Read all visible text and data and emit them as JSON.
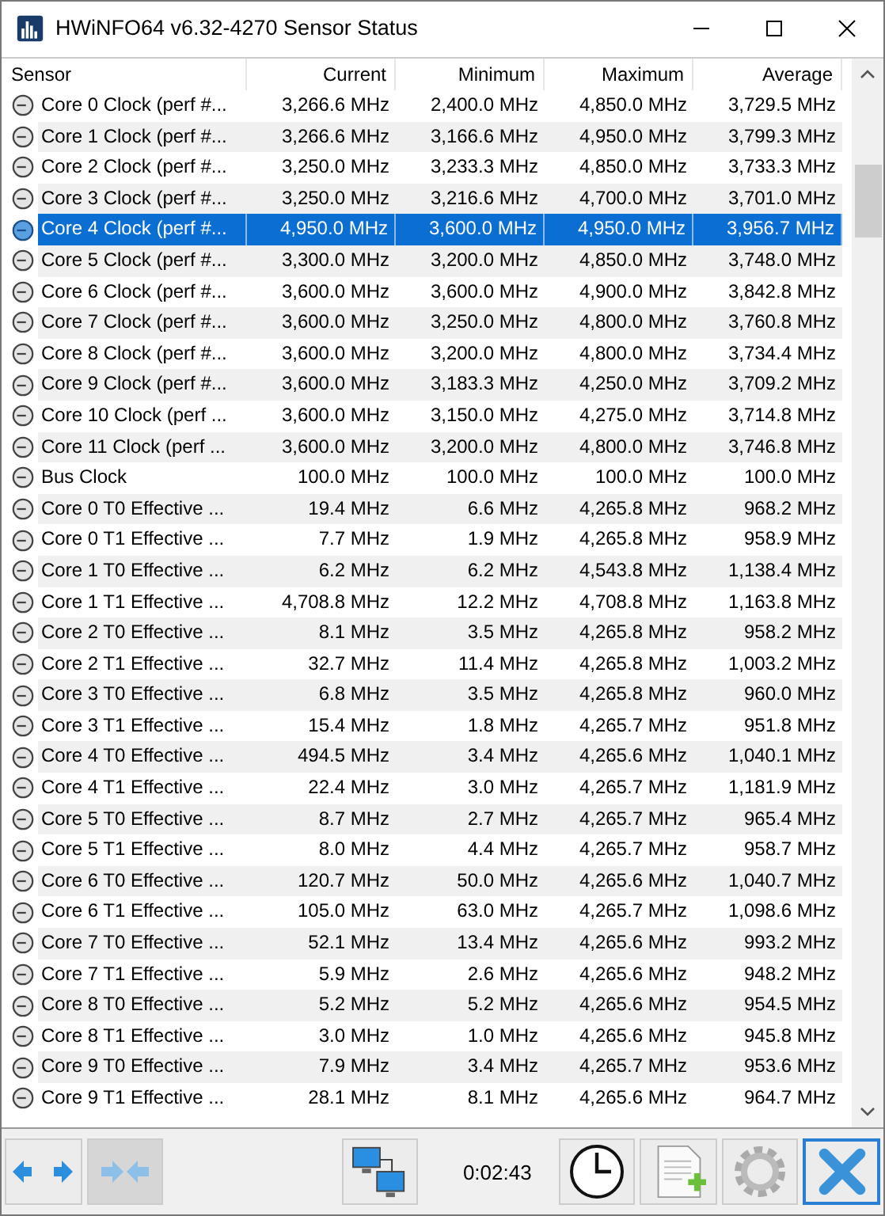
{
  "window": {
    "title": "HWiNFO64 v6.32-4270 Sensor Status"
  },
  "table": {
    "columns": [
      "Sensor",
      "Current",
      "Minimum",
      "Maximum",
      "Average"
    ],
    "rows": [
      {
        "cells": [
          "Core 0 Clock (perf #...",
          "3,266.6 MHz",
          "2,400.0 MHz",
          "4,850.0 MHz",
          "3,729.5 MHz"
        ],
        "selected": false
      },
      {
        "cells": [
          "Core 1 Clock (perf #...",
          "3,266.6 MHz",
          "3,166.6 MHz",
          "4,950.0 MHz",
          "3,799.3 MHz"
        ],
        "selected": false
      },
      {
        "cells": [
          "Core 2 Clock (perf #...",
          "3,250.0 MHz",
          "3,233.3 MHz",
          "4,850.0 MHz",
          "3,733.3 MHz"
        ],
        "selected": false
      },
      {
        "cells": [
          "Core 3 Clock (perf #...",
          "3,250.0 MHz",
          "3,216.6 MHz",
          "4,700.0 MHz",
          "3,701.0 MHz"
        ],
        "selected": false
      },
      {
        "cells": [
          "Core 4 Clock (perf #...",
          "4,950.0 MHz",
          "3,600.0 MHz",
          "4,950.0 MHz",
          "3,956.7 MHz"
        ],
        "selected": true
      },
      {
        "cells": [
          "Core 5 Clock (perf #...",
          "3,300.0 MHz",
          "3,200.0 MHz",
          "4,850.0 MHz",
          "3,748.0 MHz"
        ],
        "selected": false
      },
      {
        "cells": [
          "Core 6 Clock (perf #...",
          "3,600.0 MHz",
          "3,600.0 MHz",
          "4,900.0 MHz",
          "3,842.8 MHz"
        ],
        "selected": false
      },
      {
        "cells": [
          "Core 7 Clock (perf #...",
          "3,600.0 MHz",
          "3,250.0 MHz",
          "4,800.0 MHz",
          "3,760.8 MHz"
        ],
        "selected": false
      },
      {
        "cells": [
          "Core 8 Clock (perf #...",
          "3,600.0 MHz",
          "3,200.0 MHz",
          "4,800.0 MHz",
          "3,734.4 MHz"
        ],
        "selected": false
      },
      {
        "cells": [
          "Core 9 Clock (perf #...",
          "3,600.0 MHz",
          "3,183.3 MHz",
          "4,250.0 MHz",
          "3,709.2 MHz"
        ],
        "selected": false
      },
      {
        "cells": [
          "Core 10 Clock (perf ...",
          "3,600.0 MHz",
          "3,150.0 MHz",
          "4,275.0 MHz",
          "3,714.8 MHz"
        ],
        "selected": false
      },
      {
        "cells": [
          "Core 11 Clock (perf ...",
          "3,600.0 MHz",
          "3,200.0 MHz",
          "4,800.0 MHz",
          "3,746.8 MHz"
        ],
        "selected": false
      },
      {
        "cells": [
          "Bus Clock",
          "100.0 MHz",
          "100.0 MHz",
          "100.0 MHz",
          "100.0 MHz"
        ],
        "selected": false
      },
      {
        "cells": [
          "Core 0 T0 Effective ...",
          "19.4 MHz",
          "6.6 MHz",
          "4,265.8 MHz",
          "968.2 MHz"
        ],
        "selected": false
      },
      {
        "cells": [
          "Core 0 T1 Effective ...",
          "7.7 MHz",
          "1.9 MHz",
          "4,265.8 MHz",
          "958.9 MHz"
        ],
        "selected": false
      },
      {
        "cells": [
          "Core 1 T0 Effective ...",
          "6.2 MHz",
          "6.2 MHz",
          "4,543.8 MHz",
          "1,138.4 MHz"
        ],
        "selected": false
      },
      {
        "cells": [
          "Core 1 T1 Effective ...",
          "4,708.8 MHz",
          "12.2 MHz",
          "4,708.8 MHz",
          "1,163.8 MHz"
        ],
        "selected": false
      },
      {
        "cells": [
          "Core 2 T0 Effective ...",
          "8.1 MHz",
          "3.5 MHz",
          "4,265.8 MHz",
          "958.2 MHz"
        ],
        "selected": false
      },
      {
        "cells": [
          "Core 2 T1 Effective ...",
          "32.7 MHz",
          "11.4 MHz",
          "4,265.8 MHz",
          "1,003.2 MHz"
        ],
        "selected": false
      },
      {
        "cells": [
          "Core 3 T0 Effective ...",
          "6.8 MHz",
          "3.5 MHz",
          "4,265.8 MHz",
          "960.0 MHz"
        ],
        "selected": false
      },
      {
        "cells": [
          "Core 3 T1 Effective ...",
          "15.4 MHz",
          "1.8 MHz",
          "4,265.7 MHz",
          "951.8 MHz"
        ],
        "selected": false
      },
      {
        "cells": [
          "Core 4 T0 Effective ...",
          "494.5 MHz",
          "3.4 MHz",
          "4,265.6 MHz",
          "1,040.1 MHz"
        ],
        "selected": false
      },
      {
        "cells": [
          "Core 4 T1 Effective ...",
          "22.4 MHz",
          "3.0 MHz",
          "4,265.7 MHz",
          "1,181.9 MHz"
        ],
        "selected": false
      },
      {
        "cells": [
          "Core 5 T0 Effective ...",
          "8.7 MHz",
          "2.7 MHz",
          "4,265.7 MHz",
          "965.4 MHz"
        ],
        "selected": false
      },
      {
        "cells": [
          "Core 5 T1 Effective ...",
          "8.0 MHz",
          "4.4 MHz",
          "4,265.7 MHz",
          "958.7 MHz"
        ],
        "selected": false
      },
      {
        "cells": [
          "Core 6 T0 Effective ...",
          "120.7 MHz",
          "50.0 MHz",
          "4,265.6 MHz",
          "1,040.7 MHz"
        ],
        "selected": false
      },
      {
        "cells": [
          "Core 6 T1 Effective ...",
          "105.0 MHz",
          "63.0 MHz",
          "4,265.7 MHz",
          "1,098.6 MHz"
        ],
        "selected": false
      },
      {
        "cells": [
          "Core 7 T0 Effective ...",
          "52.1 MHz",
          "13.4 MHz",
          "4,265.6 MHz",
          "993.2 MHz"
        ],
        "selected": false
      },
      {
        "cells": [
          "Core 7 T1 Effective ...",
          "5.9 MHz",
          "2.6 MHz",
          "4,265.6 MHz",
          "948.2 MHz"
        ],
        "selected": false
      },
      {
        "cells": [
          "Core 8 T0 Effective ...",
          "5.2 MHz",
          "5.2 MHz",
          "4,265.6 MHz",
          "954.5 MHz"
        ],
        "selected": false
      },
      {
        "cells": [
          "Core 8 T1 Effective ...",
          "3.0 MHz",
          "1.0 MHz",
          "4,265.6 MHz",
          "945.8 MHz"
        ],
        "selected": false
      },
      {
        "cells": [
          "Core 9 T0 Effective ...",
          "7.9 MHz",
          "3.4 MHz",
          "4,265.7 MHz",
          "953.6 MHz"
        ],
        "selected": false
      },
      {
        "cells": [
          "Core 9 T1 Effective ...",
          "28.1 MHz",
          "8.1 MHz",
          "4,265.6 MHz",
          "964.7 MHz"
        ],
        "selected": false
      }
    ]
  },
  "toolbar": {
    "elapsed": "0:02:43"
  }
}
